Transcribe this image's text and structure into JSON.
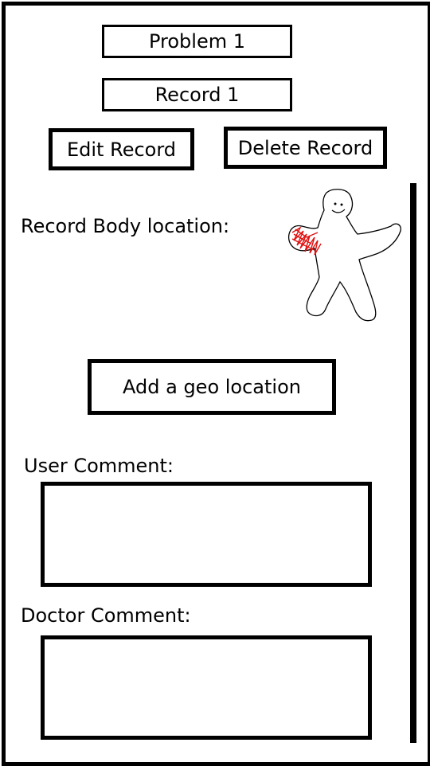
{
  "header": {
    "problem_title": "Problem 1",
    "record_title": "Record 1"
  },
  "actions": {
    "edit_label": "Edit Record",
    "delete_label": "Delete Record"
  },
  "body_location": {
    "label": "Record Body location:",
    "figure_icon": "stick-figure-icon",
    "highlight_color": "#e01010"
  },
  "geo": {
    "button_label": "Add a geo location"
  },
  "comments": {
    "user_label": "User Comment:",
    "doctor_label": "Doctor Comment:"
  }
}
